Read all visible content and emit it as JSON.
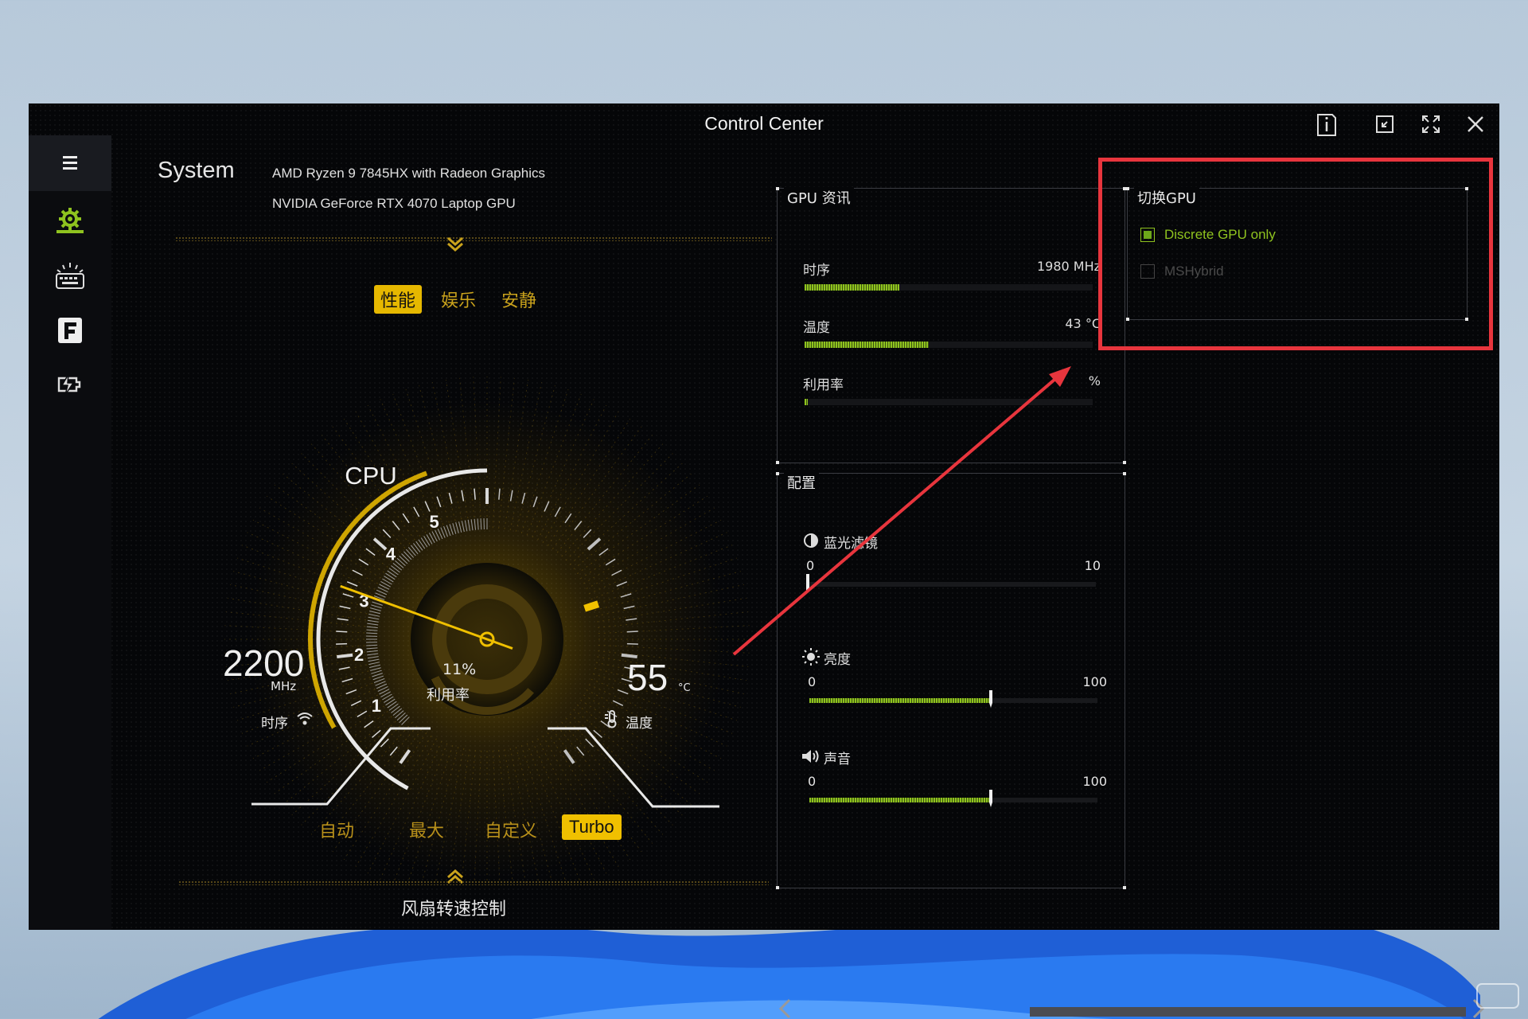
{
  "window": {
    "title": "Control Center"
  },
  "titlebar_buttons": [
    "info-icon",
    "restore-icon",
    "fullscreen-icon",
    "close-icon"
  ],
  "sidebar": {
    "items": [
      {
        "icon": "menu-icon",
        "name": "menu"
      },
      {
        "icon": "system-gear-icon",
        "name": "system",
        "active": true
      },
      {
        "icon": "keyboard-backlight-icon",
        "name": "keyboard"
      },
      {
        "icon": "flexikey-f-icon",
        "name": "flexikey"
      },
      {
        "icon": "battery-power-icon",
        "name": "power"
      }
    ]
  },
  "system": {
    "label": "System",
    "cpu_name": "AMD Ryzen 9 7845HX with Radeon Graphics",
    "gpu_name": "NVIDIA GeForce RTX 4070 Laptop GPU"
  },
  "modes": {
    "tabs": [
      "性能",
      "娱乐",
      "安静"
    ],
    "active": 0
  },
  "cpu_gauge": {
    "label": "CPU",
    "scale_labels": [
      "1",
      "2",
      "3",
      "4",
      "5"
    ],
    "needle_value": 3.1,
    "scale_max": 6,
    "clock_value": "2200",
    "clock_unit": "MHz",
    "clock_label": "时序",
    "usage_value": "11%",
    "usage_label": "利用率",
    "usage_fraction": 0.11,
    "temp_value": "55",
    "temp_unit": "°C",
    "temp_label": "温度"
  },
  "fan_modes": {
    "items": [
      "自动",
      "最大",
      "自定义",
      "Turbo"
    ],
    "active": 3,
    "footer_label": "风扇转速控制"
  },
  "gpu_info": {
    "title": "GPU 资讯",
    "rows": [
      {
        "label": "时序",
        "value": "1980 MHz",
        "fraction": 0.33
      },
      {
        "label": "温度",
        "value": "43 °C",
        "fraction": 0.43
      },
      {
        "label": "利用率",
        "value": "%",
        "fraction": 0.01
      }
    ]
  },
  "config": {
    "title": "配置",
    "sliders": [
      {
        "icon": "blue-light-filter-icon",
        "label": "蓝光滤镜",
        "min": "0",
        "max": "10",
        "value": 0,
        "range": 10
      },
      {
        "icon": "brightness-icon",
        "label": "亮度",
        "min": "0",
        "max": "100",
        "value": 63,
        "range": 100
      },
      {
        "icon": "volume-icon",
        "label": "声音",
        "min": "0",
        "max": "100",
        "value": 63,
        "range": 100
      }
    ]
  },
  "gpu_switch": {
    "title": "切换GPU",
    "options": [
      {
        "label": "Discrete GPU only",
        "checked": true
      },
      {
        "label": "MSHybrid",
        "checked": false
      }
    ]
  },
  "colors": {
    "accent_yellow": "#f0c000",
    "accent_green": "#8fc31f",
    "annotation_red": "#e8353d",
    "background": "#050608"
  }
}
